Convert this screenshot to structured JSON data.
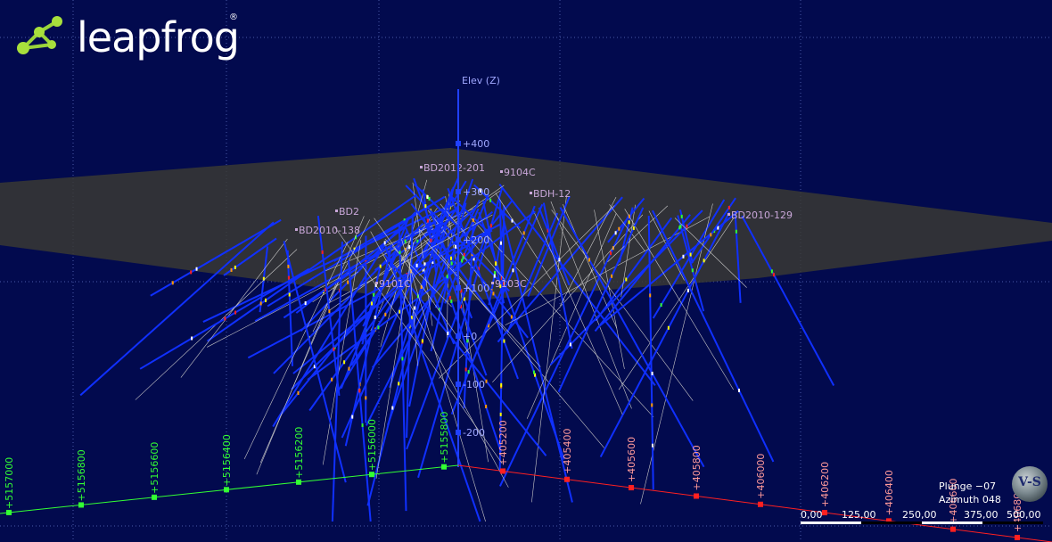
{
  "app": {
    "logo_text": "leapfrog",
    "logo_mark": "®"
  },
  "colors": {
    "background": "#020a4e",
    "grid": "#4a5aa8",
    "northing_axis": "#33ff33",
    "easting_axis": "#ff2020",
    "elev_axis": "#2040ff",
    "drillhole_trace": "#1030ff",
    "collar_label": "#c8a6d8",
    "topography": "#3a3a32"
  },
  "elev_axis": {
    "title": "Elev (Z)",
    "ticks": [
      "+400",
      "+300",
      "+200",
      "+100",
      "+0",
      "-100",
      "-200"
    ]
  },
  "northing_axis": {
    "ticks": [
      "+5157000",
      "+5156800",
      "+5156600",
      "+5156400",
      "+5156200",
      "+5156000",
      "+5155800"
    ]
  },
  "easting_axis": {
    "ticks": [
      "+405200",
      "+405400",
      "+405600",
      "+405800",
      "+406000",
      "+406200",
      "+406400",
      "+406600",
      "+406800"
    ]
  },
  "collar_labels": [
    "BD2012-201",
    "9104C",
    "BD2010-138",
    "BD2010-129",
    "9103C",
    "9101C",
    "BDH-12",
    "BD2"
  ],
  "orientation": {
    "plunge": "Plunge −07",
    "azimuth": "Azimuth 048",
    "compass_text": "V-S"
  },
  "scale_bar": {
    "labels": [
      "0,00",
      "125,00",
      "250,00",
      "375,00",
      "500,00"
    ]
  }
}
